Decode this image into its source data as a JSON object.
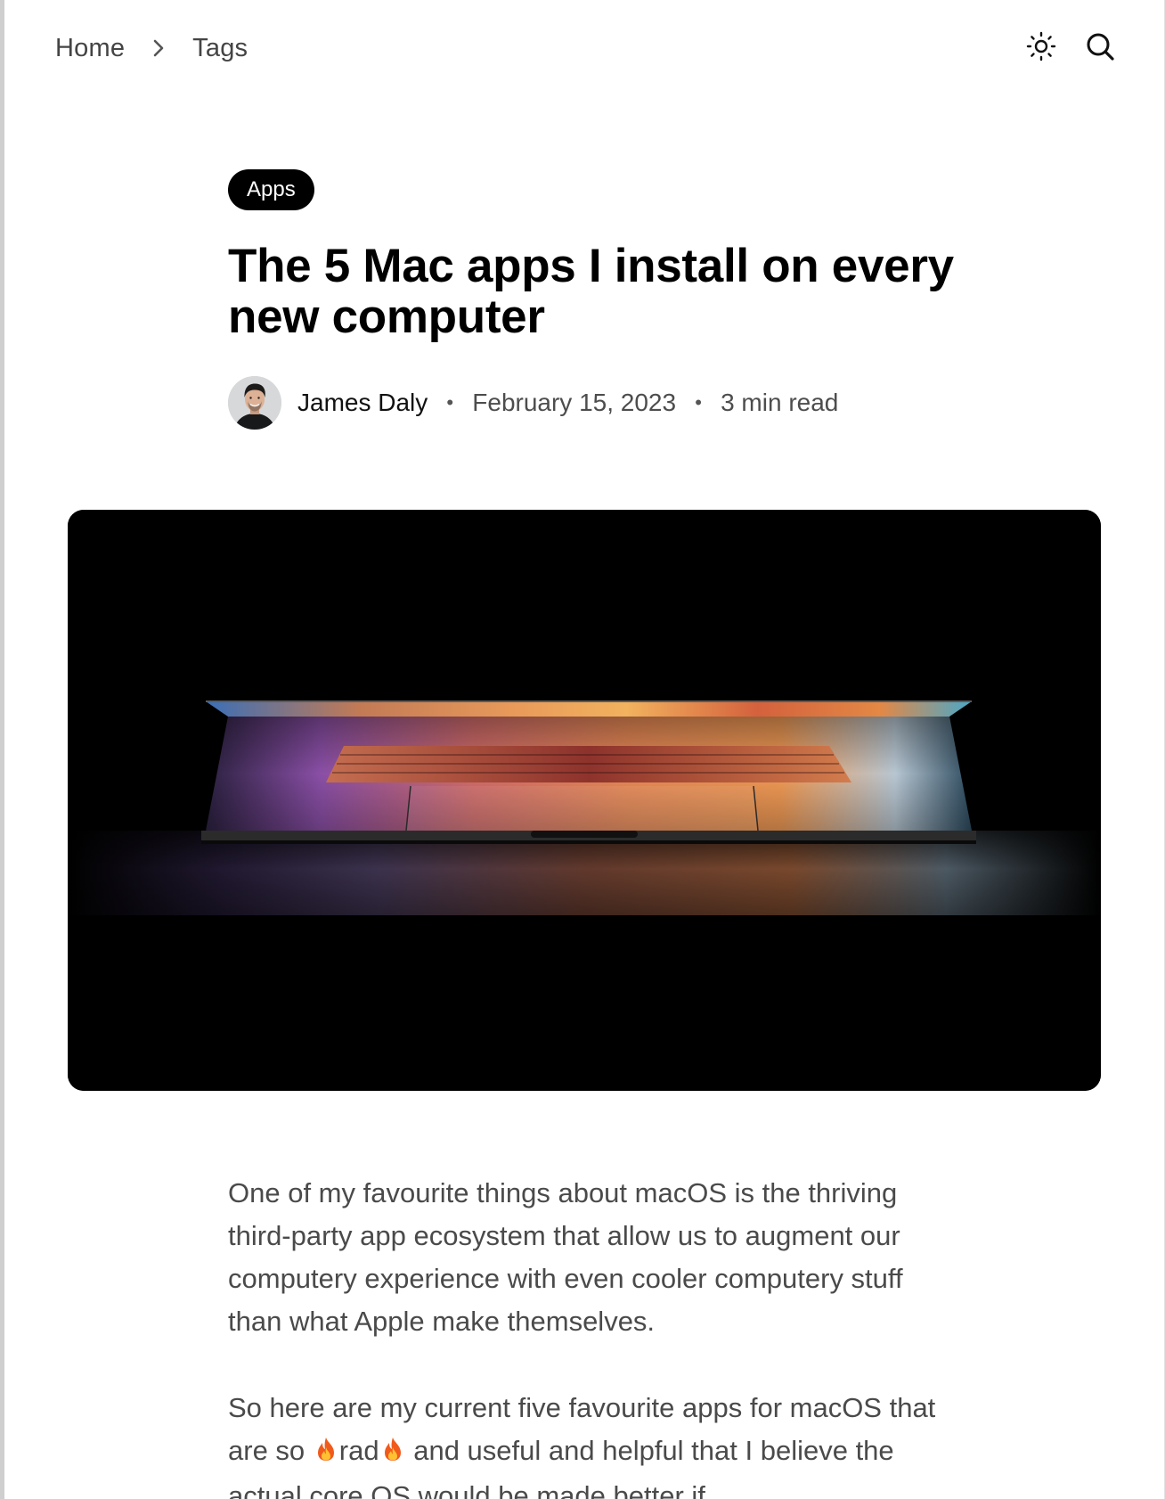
{
  "nav": {
    "breadcrumb": [
      {
        "label": "Home"
      },
      {
        "label": "Tags"
      }
    ],
    "theme_icon": "sun-icon",
    "search_icon": "search-icon",
    "separator_icon": "chevron-right-icon"
  },
  "article": {
    "tag": "Apps",
    "title": "The 5 Mac apps I install on every new computer",
    "author": "James Daly",
    "date": "February 15, 2023",
    "read_time": "3 min read",
    "meta_separator": "•",
    "paragraph_1": "One of my favourite things about macOS is the thriving third-party app ecosystem that allow us to augment our computery experience with even cooler computery stuff than what Apple make themselves.",
    "paragraph_2": {
      "part_1": "So here are my current five favourite apps for macOS that are so ",
      "part_2": "rad",
      "part_3": " and useful and helpful that I believe the actual core OS would be made better if"
    },
    "emoji_icon": "fire-emoji-icon"
  },
  "colors": {
    "text": "#111111",
    "muted_text": "#4a4a4a",
    "pill_background": "#000000",
    "pill_text": "#ffffff",
    "page_background": "#ffffff"
  }
}
